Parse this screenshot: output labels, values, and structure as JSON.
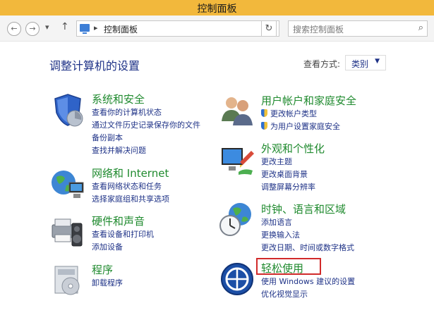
{
  "window": {
    "title": "控制面板"
  },
  "nav": {
    "back_icon": "back-arrow-icon",
    "forward_icon": "forward-arrow-icon",
    "recent_icon": "chevron-down-icon",
    "up_icon": "up-arrow-icon",
    "address": "控制面板",
    "address_separator": "▸",
    "search_placeholder": "搜索控制面板"
  },
  "header": {
    "title": "调整计算机的设置",
    "view_by_label": "查看方式:",
    "view_by_value": "类别"
  },
  "left_categories": [
    {
      "title": "系统和安全",
      "icon": "system-security-icon",
      "links": [
        "查看你的计算机状态",
        "通过文件历史记录保存你的文件",
        "备份副本",
        "查找并解决问题"
      ]
    },
    {
      "title": "网络和 Internet",
      "icon": "network-icon",
      "links": [
        "查看网络状态和任务",
        "选择家庭组和共享选项"
      ]
    },
    {
      "title": "硬件和声音",
      "icon": "hardware-sound-icon",
      "links": [
        "查看设备和打印机",
        "添加设备"
      ]
    },
    {
      "title": "程序",
      "icon": "programs-icon",
      "links": [
        "卸载程序"
      ]
    }
  ],
  "right_categories": [
    {
      "title": "用户帐户和家庭安全",
      "icon": "user-accounts-icon",
      "links": [
        "更改帐户类型",
        "为用户设置家庭安全"
      ]
    },
    {
      "title": "外观和个性化",
      "icon": "appearance-icon",
      "links": [
        "更改主题",
        "更改桌面背景",
        "调整屏幕分辨率"
      ]
    },
    {
      "title": "时钟、语言和区域",
      "icon": "clock-language-icon",
      "links": [
        "添加语言",
        "更换输入法",
        "更改日期、时间或数字格式"
      ]
    },
    {
      "title": "轻松使用",
      "icon": "ease-of-access-icon",
      "links": [
        "使用 Windows 建议的设置",
        "优化视觉显示"
      ]
    }
  ],
  "colors": {
    "titlebar": "#f2b83c",
    "category_title": "#1f8a2e",
    "link": "#1e3287",
    "highlight_border": "#d12a2a"
  }
}
